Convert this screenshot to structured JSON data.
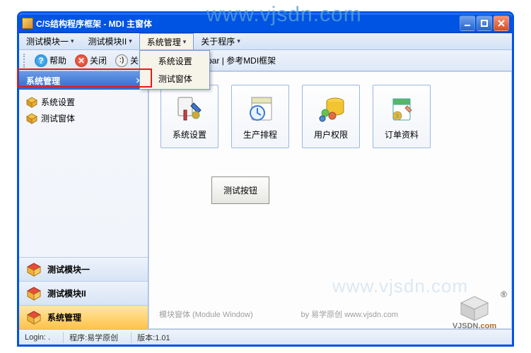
{
  "window": {
    "title": "C/S结构程序框架 - MDI 主窗体"
  },
  "menubar": {
    "items": [
      "测试模块一",
      "测试模块II",
      "系统管理",
      "关于程序"
    ],
    "active_index": 2,
    "dropdown": [
      "系统设置",
      "测试窗体"
    ]
  },
  "toolbar": {
    "help": "帮助",
    "close": "关闭",
    "about_fragment": "关",
    "rest": "oolbar | 参考MDI框架"
  },
  "sidebar": {
    "header": "系统管理",
    "tree": [
      "系统设置",
      "测试窗体"
    ],
    "nav": [
      "测试模块一",
      "测试模块II",
      "系统管理"
    ],
    "nav_active_index": 2
  },
  "content": {
    "tiles": [
      "系统设置",
      "生产排程",
      "用户权限",
      "订单资料"
    ],
    "mid_button": "测试按钮",
    "footer_left": "模块窗体 (Module Window)",
    "footer_right": "by 易学原创 www.vjsdn.com"
  },
  "statusbar": {
    "login": "Login: .",
    "program": "程序:易学原创",
    "version": "版本:1.01"
  },
  "watermark": "www.vjsdn.com",
  "logo": {
    "brand": "VJSDN",
    "domain": ".com",
    "reg": "®"
  }
}
